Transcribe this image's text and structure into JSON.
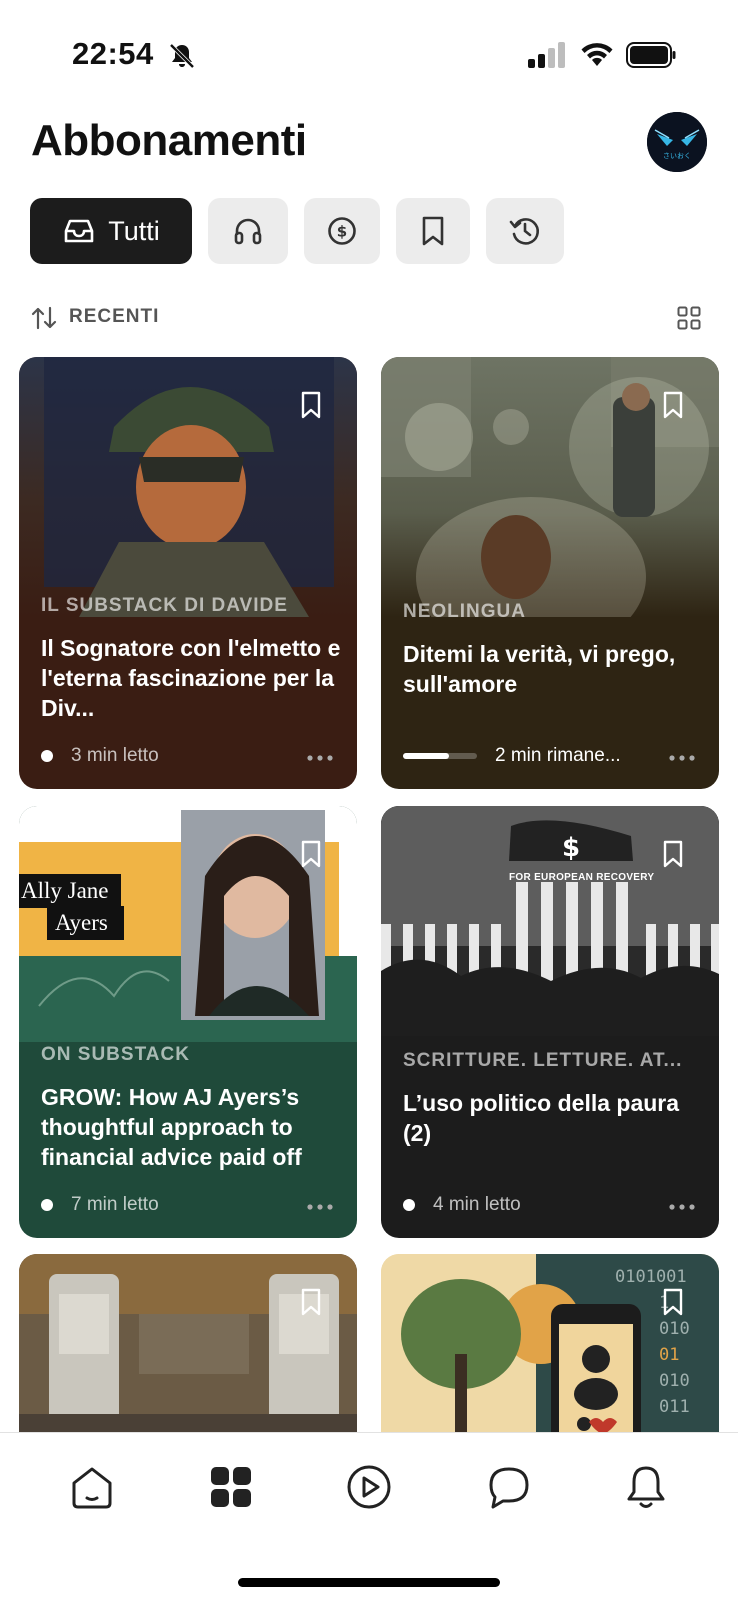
{
  "status_bar": {
    "time": "22:54"
  },
  "header": {
    "title": "Abbonamenti"
  },
  "filters": {
    "all_label": "Tutti",
    "icons": [
      "inbox-icon",
      "headphones-icon",
      "dollar-icon",
      "bookmark-icon",
      "history-icon"
    ]
  },
  "sort": {
    "label": "RECENTI"
  },
  "cards": [
    {
      "publication": "IL SUBSTACK DI DAVIDE",
      "title": "Il Sognatore con l'elmetto e l'eterna fascinazione per la Div...",
      "meta": "3 min letto"
    },
    {
      "publication": "NEOLINGUA",
      "title": "Ditemi la verità, vi prego, sull'amore",
      "meta": "2 min rimane...",
      "progress": 0.62
    },
    {
      "publication": "ON SUBSTACK",
      "title": "GROW: How AJ Ayers’s thoughtful approach to financial advice paid off",
      "meta": "7 min letto",
      "image_text": [
        "Ally Jane",
        "Ayers"
      ]
    },
    {
      "publication": "SCRITTURE. LETTURE. AT...",
      "title": "L’uso politico della paura (2)",
      "meta": "4 min letto",
      "image_text": [
        "FOR EUROPEAN RECOVERY"
      ]
    },
    {
      "publication": "",
      "title": "",
      "meta": ""
    },
    {
      "publication": "",
      "title": "",
      "meta": "",
      "image_text": [
        "0101001",
        "1",
        "010",
        "01",
        "010",
        "011"
      ]
    }
  ],
  "colors": {
    "card1_bg": "#3a1d13",
    "card2_bg": "#2e2413",
    "card3_bg": "#1f4a3a",
    "card4_bg": "#1c1c1c",
    "chip_active": "#1c1c1c",
    "chip_bg": "#ececec"
  },
  "tabbar": {
    "icons": [
      "home-icon",
      "grid-icon",
      "play-icon",
      "chat-icon",
      "bell-icon"
    ]
  }
}
